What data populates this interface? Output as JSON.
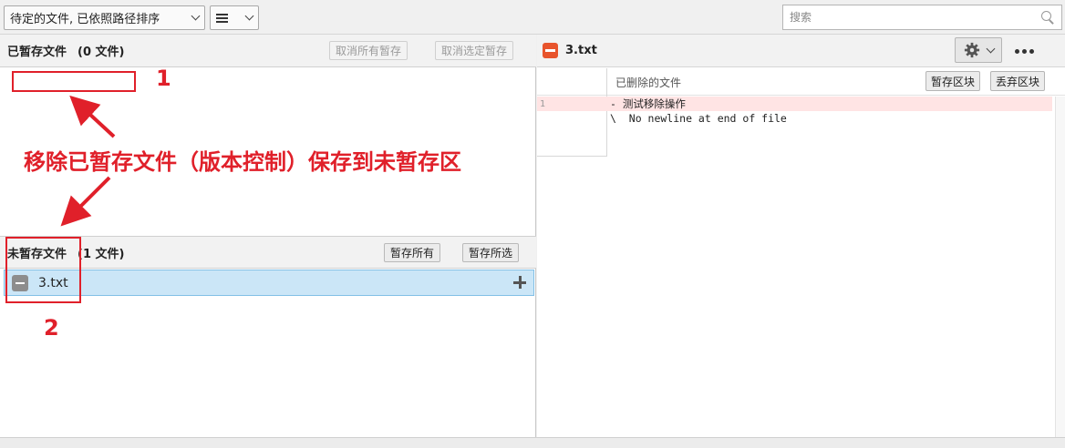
{
  "toolbar": {
    "sort_dropdown": "待定的文件, 已依照路径排序",
    "view_icon": "hamburger-list-icon",
    "search_placeholder": "搜索"
  },
  "staged": {
    "title": "已暂存文件",
    "count": "(0 文件)",
    "unstage_all": "取消所有暂存",
    "unstage_selected": "取消选定暂存"
  },
  "unstaged": {
    "title": "未暂存文件",
    "count": "(1 文件)",
    "stage_all": "暂存所有",
    "stage_selected": "暂存所选",
    "files": [
      {
        "name": "3.txt",
        "status": "removed"
      }
    ]
  },
  "diff": {
    "file": "3.txt",
    "hunk_label": "已删除的文件",
    "stage_hunk": "暂存区块",
    "discard_hunk": "丢弃区块",
    "lines": [
      {
        "ln": "1",
        "text": "- 测试移除操作",
        "type": "removed"
      },
      {
        "ln": "",
        "text": "\\  No newline at end of file",
        "type": "meta"
      }
    ]
  },
  "annotations": {
    "label1": "1",
    "label2": "2",
    "caption": "移除已暂存文件（版本控制）保存到未暂存区"
  },
  "colors": {
    "annotation": "#e0202a",
    "selected_row": "#cbe6f7",
    "removed_badge": "#e8542c",
    "removed_line": "#ffe4e4"
  }
}
